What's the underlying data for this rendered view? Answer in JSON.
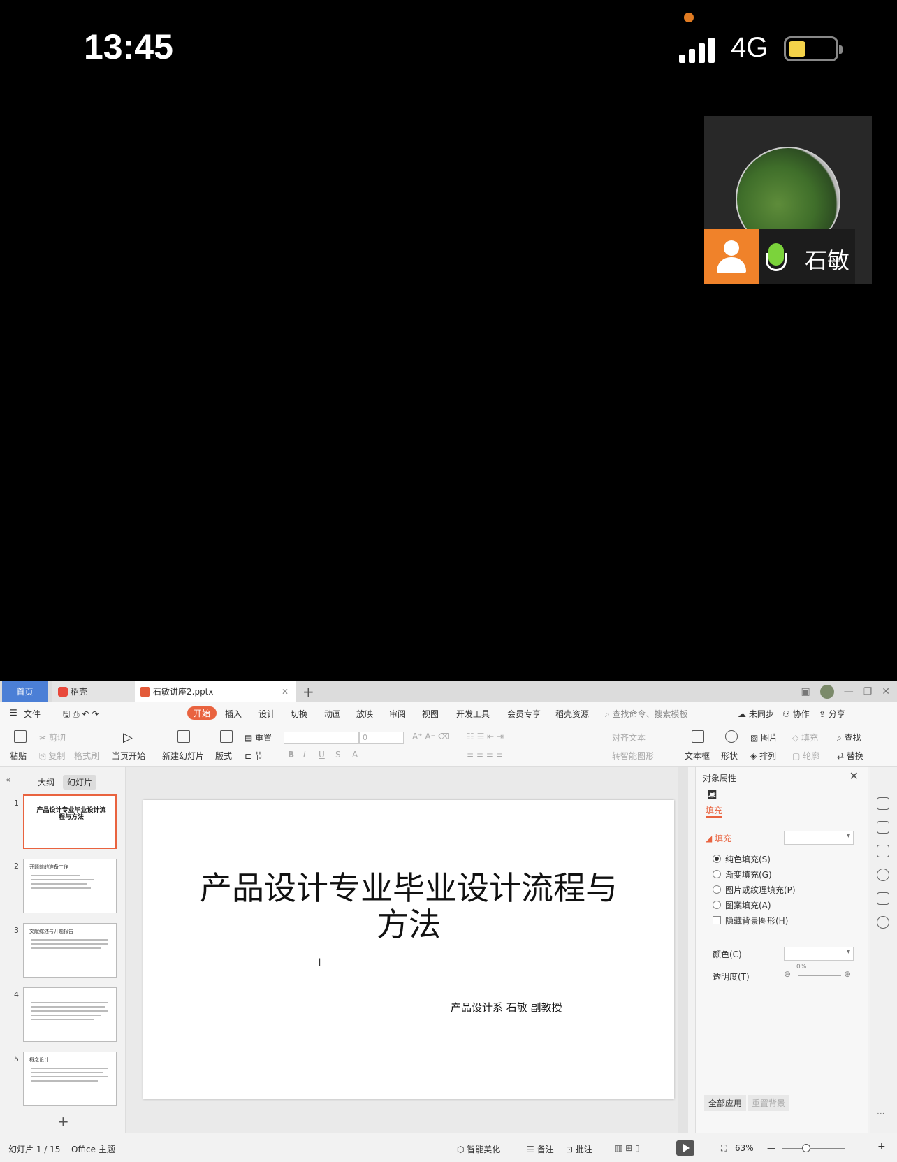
{
  "status_bar": {
    "time": "13:45",
    "network": "4G",
    "signal_bars": 4,
    "battery_level": 0.35,
    "accent_color": "#e07b22"
  },
  "video_tile": {
    "participant_name": "石敏",
    "mic_active": true
  },
  "wps": {
    "tabs": {
      "home": "首页",
      "daoke": "稻壳",
      "document": "石敏讲座2.pptx",
      "add": "+"
    },
    "menu": {
      "file": "文件",
      "items": [
        "开始",
        "插入",
        "设计",
        "切换",
        "动画",
        "放映",
        "审阅",
        "视图",
        "开发工具",
        "会员专享",
        "稻壳资源"
      ],
      "search_placeholder": "查找命令、搜索模板",
      "sync": "未同步",
      "collab": "协作",
      "share": "分享"
    },
    "ribbon": {
      "paste": "粘贴",
      "cut": "剪切",
      "copy": "复制",
      "format_painter": "格式刷",
      "from_current": "当页开始",
      "new_slide": "新建幻灯片",
      "layout": "版式",
      "reset": "重置",
      "section": "节",
      "font_size": "0",
      "align_text": "对齐文本",
      "smart_art": "转智能图形",
      "text_box": "文本框",
      "shape": "形状",
      "picture": "图片",
      "arrange": "排列",
      "fill": "填充",
      "outline": "轮廓",
      "find": "查找",
      "replace": "替换"
    },
    "left_panel": {
      "outline_tab": "大纲",
      "slides_tab": "幻灯片",
      "add": "+",
      "thumbs": [
        {
          "num": "1",
          "title": "产品设计专业毕业设计流程与方法"
        },
        {
          "num": "2",
          "title": "开题前的准备工作"
        },
        {
          "num": "3",
          "title": "文献综述与开题报告"
        },
        {
          "num": "4",
          "title": ""
        },
        {
          "num": "5",
          "title": "概念设计"
        }
      ]
    },
    "slide": {
      "title": "产品设计专业毕业设计流程与方法",
      "subtitle": "产品设计系  石敏  副教授"
    },
    "right_panel": {
      "header": "对象属性",
      "fill_tab": "填充",
      "fill_section": "填充",
      "options": [
        "纯色填充(S)",
        "渐变填充(G)",
        "图片或纹理填充(P)",
        "图案填充(A)"
      ],
      "hide_bg": "隐藏背景图形(H)",
      "color_label": "颜色(C)",
      "transparency_label": "透明度(T)",
      "transparency_value": "0%",
      "apply_all": "全部应用",
      "reset_bg": "重置背景"
    },
    "statusbar": {
      "slide_pos": "幻灯片 1 / 15",
      "theme": "Office 主题",
      "beautify": "智能美化",
      "notes": "备注",
      "comments": "批注",
      "zoom": "63%"
    },
    "accent_color": "#e9633f"
  }
}
